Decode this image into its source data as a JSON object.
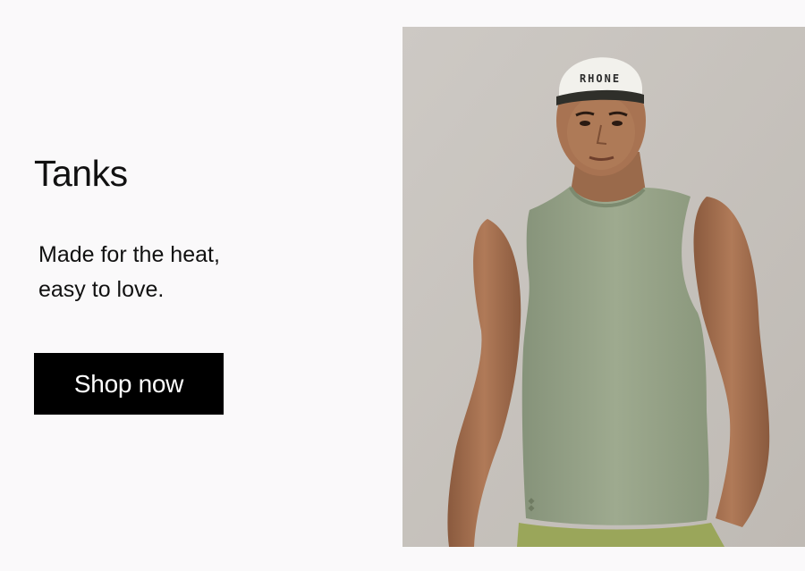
{
  "promo": {
    "title": "Tanks",
    "tagline": "Made for the heat, easy to love.",
    "cta_label": "Shop now"
  },
  "image": {
    "alt": "Man wearing a sage green tank top and white cap",
    "cap_text": "RHONE"
  },
  "colors": {
    "background": "#faf9fa",
    "button_bg": "#000000",
    "button_text": "#ffffff",
    "tank": "#97a387",
    "shorts": "#9aa65a",
    "wall": "#c9c5c0"
  }
}
